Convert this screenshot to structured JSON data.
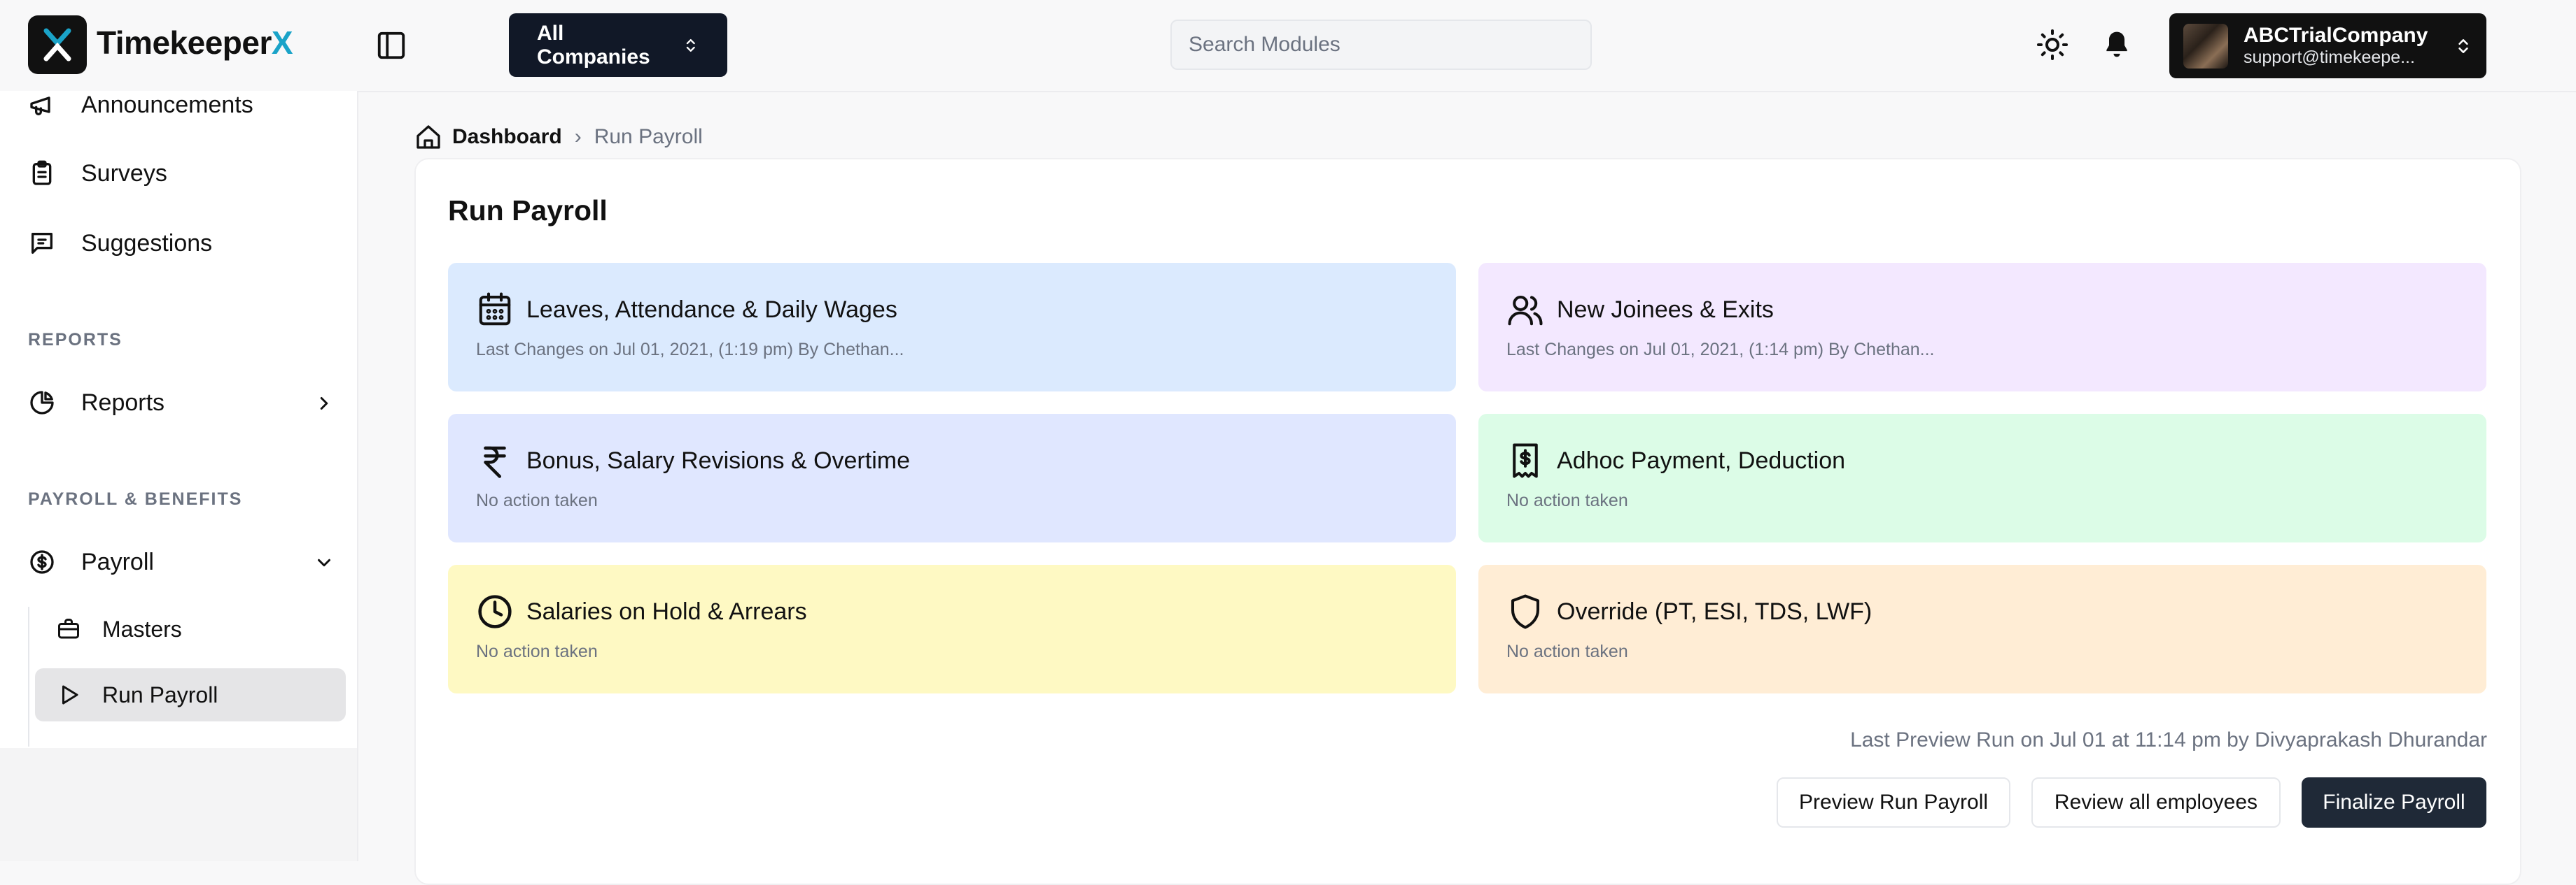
{
  "app": {
    "name_main": "Timekeeper",
    "name_accent": "X"
  },
  "header": {
    "company_select_label": "All Companies",
    "search_placeholder": "Search Modules",
    "account": {
      "name": "ABCTrialCompany",
      "email": "support@timekeepe..."
    }
  },
  "sidebar": {
    "items_top": [
      {
        "label": "Announcements",
        "icon": "megaphone-icon"
      },
      {
        "label": "Surveys",
        "icon": "clipboard-icon"
      },
      {
        "label": "Suggestions",
        "icon": "message-square-icon"
      }
    ],
    "section_reports": "REPORTS",
    "reports_label": "Reports",
    "section_payroll": "PAYROLL & BENEFITS",
    "payroll_label": "Payroll",
    "payroll_children": [
      {
        "label": "Masters",
        "icon": "briefcase-icon"
      },
      {
        "label": "Run Payroll",
        "icon": "play-icon",
        "active": true
      }
    ]
  },
  "breadcrumb": {
    "home": "Dashboard",
    "current": "Run Payroll"
  },
  "main": {
    "title": "Run Payroll",
    "cards": [
      {
        "title": "Leaves, Attendance & Daily Wages",
        "subtitle": "Last Changes on Jul 01, 2021, (1:19 pm) By Chethan...",
        "icon": "calendar-icon",
        "bg": "#dbeafe"
      },
      {
        "title": "New Joinees & Exits",
        "subtitle": "Last Changes on Jul 01, 2021, (1:14 pm) By Chethan...",
        "icon": "users-icon",
        "bg": "#f3e8ff"
      },
      {
        "title": "Bonus, Salary Revisions & Overtime",
        "subtitle": "No action taken",
        "icon": "rupee-icon",
        "bg": "#e0e7ff"
      },
      {
        "title": "Adhoc Payment, Deduction",
        "subtitle": "No action taken",
        "icon": "receipt-icon",
        "bg": "#dcfce7"
      },
      {
        "title": "Salaries on Hold & Arrears",
        "subtitle": "No action taken",
        "icon": "clock-icon",
        "bg": "#fef9c3"
      },
      {
        "title": "Override (PT, ESI, TDS, LWF)",
        "subtitle": "No action taken",
        "icon": "shield-icon",
        "bg": "#ffedd5"
      }
    ],
    "last_preview_run": "Last Preview Run on Jul 01 at 11:14 pm by Divyaprakash Dhurandar",
    "buttons": {
      "preview": "Preview Run Payroll",
      "review": "Review all employees",
      "finalize": "Finalize Payroll"
    }
  },
  "colors": {
    "accent": "#1aa3c8",
    "dark": "#111827"
  }
}
